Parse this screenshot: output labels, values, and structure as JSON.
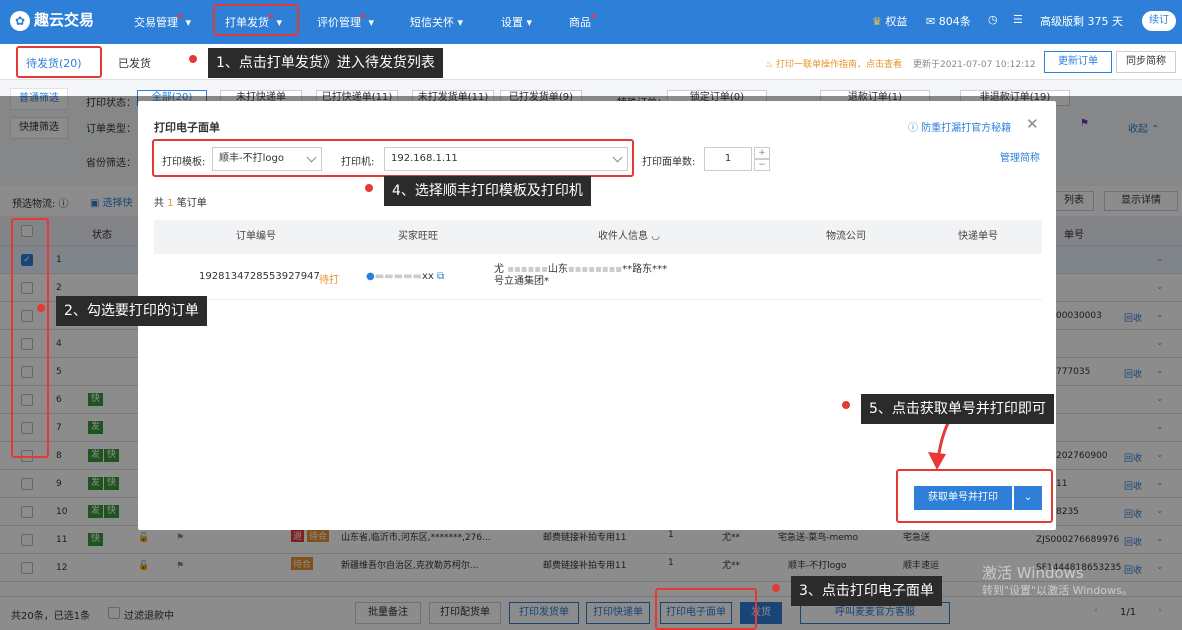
{
  "topbar": {
    "logo": "趣云交易",
    "nav": [
      "交易管理",
      "打单发货",
      "评价管理",
      "短信关怀",
      "设置",
      "商品"
    ],
    "benefits": "权益",
    "messages": "804条",
    "version": "高级版剩 375 天",
    "renew": "续订"
  },
  "subbar": {
    "tab_pending": "待发货(20)",
    "tab_shipped": "已发货",
    "guide": "打印一联单操作指南，点击查看",
    "updated": "更新于2021-07-07 10:12:12",
    "update_btn": "更新订单",
    "sync_btn": "同步简称"
  },
  "filter": {
    "side1": "普通筛选",
    "side2": "快捷筛选",
    "print_status": "打印状态：",
    "order_type": "订单类型：",
    "province": "省份筛选：",
    "all": "全部(20)",
    "unprinted_exp": "未打快递单",
    "printed_exp": "已打快递单(11)",
    "unprinted_ship": "未打发货单(11)",
    "printed_ship": "已打发货单(9)",
    "special": "特殊订单：",
    "locked": "锁定订单(0)",
    "refund": "退款订单(1)",
    "abnormal": "非退款订单(19)",
    "collapse": "收起",
    "preset_logistics": "预选物流:",
    "select_express": "选择快",
    "list_btn": "列表",
    "show_detail": "显示详情",
    "status_col": "状态",
    "express_col": "单号"
  },
  "bg_rows": {
    "row_nums": [
      "1",
      "2",
      "3",
      "4",
      "5",
      "6",
      "7",
      "8",
      "9",
      "10",
      "11",
      "12"
    ],
    "tag_kuai": "快",
    "tag_fa": "发",
    "rt_nums": [
      "00030003",
      "777035",
      "202760900",
      "11",
      "8235",
      "ZJS000276689976",
      "SF1444818653235"
    ],
    "recall": "回收",
    "row11": {
      "addr": "山东省,临沂市,河东区,*******,276...",
      "item": "邮费链接补拍专用11",
      "qty": "1",
      "name": "尤**",
      "express": "宅急送-菜鸟-memo",
      "company": "宅急送",
      "badge1": "退",
      "badge2": "待合"
    },
    "row12": {
      "addr": "新疆维吾尔自治区,克孜勒苏柯尔...",
      "item": "邮费链接补拍专用11",
      "qty": "1",
      "name": "尤**",
      "express": "顺丰-不打logo",
      "company": "顺丰速运",
      "badge2": "待合"
    }
  },
  "modal": {
    "title": "打印电子面单",
    "help": "防重打漏打官方秘籍",
    "template_label": "打印模板:",
    "template_value": "顺丰-不打logo",
    "printer_label": "打印机:",
    "printer_value": "192.168.1.11",
    "count_label": "打印面单数:",
    "count_value": "1",
    "manage": "管理简称",
    "total_pre": "共",
    "total_num": "1",
    "total_post": "笔订单",
    "columns": [
      "订单编号",
      "买家旺旺",
      "收件人信息",
      "物流公司",
      "快递单号"
    ],
    "order_id": "1928134728553927947",
    "status": "待打",
    "buyer": "xx",
    "addr_line1": "尤",
    "addr_mid": "山东",
    "addr_tail": "**路东***",
    "addr_line2": "号立通集团*",
    "submit": "获取单号并打印"
  },
  "bottom": {
    "summary": "共20条，已选1条",
    "filter_refund": "过滤退款中",
    "batch_note": "批量备注",
    "print_ship": "打印配货单",
    "print_send": "打印发货单",
    "print_express": "打印快递单",
    "print_e": "打印电子面单",
    "ship": "发货",
    "official": "呼叫麦麦官方客服",
    "page": "1/1"
  },
  "tips": {
    "t1": "1、点击打单发货》进入待发货列表",
    "t2": "2、勾选要打印的订单",
    "t3": "3、点击打印电子面单",
    "t4": "4、选择顺丰打印模板及打印机",
    "t5": "5、点击获取单号并打印即可"
  },
  "watermark": {
    "line1": "激活 Windows",
    "line2": "转到\"设置\"以激活 Windows。"
  },
  "colors": {
    "brand": "#2d7fd8",
    "annotation": "#e53935",
    "tag_green": "#3a9a3a"
  }
}
